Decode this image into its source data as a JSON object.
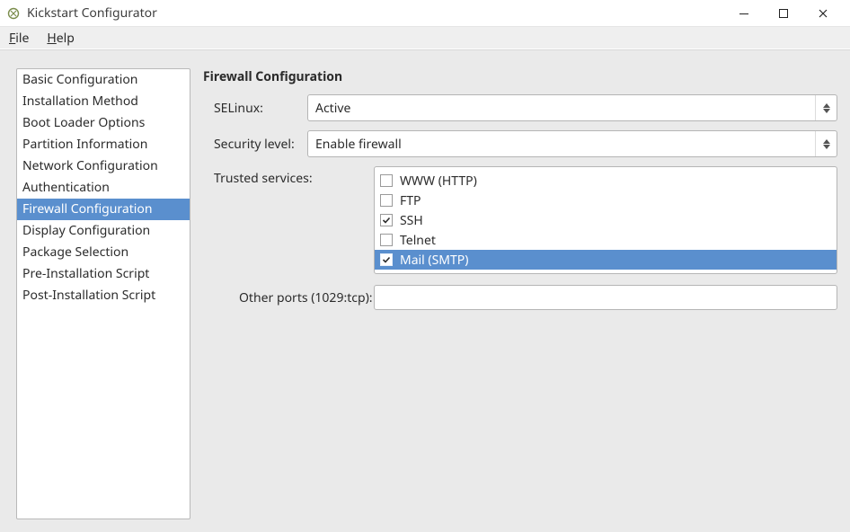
{
  "window": {
    "title": "Kickstart Configurator"
  },
  "menu": {
    "file": "File",
    "help": "Help"
  },
  "sidebar": {
    "items": [
      "Basic Configuration",
      "Installation Method",
      "Boot Loader Options",
      "Partition Information",
      "Network Configuration",
      "Authentication",
      "Firewall Configuration",
      "Display Configuration",
      "Package Selection",
      "Pre-Installation Script",
      "Post-Installation Script"
    ],
    "selected_index": 6
  },
  "panel": {
    "title": "Firewall Configuration",
    "selinux_label": "SELinux:",
    "selinux_value": "Active",
    "security_level_label": "Security level:",
    "security_level_value": "Enable firewall",
    "trusted_services_label": "Trusted services:",
    "services": [
      {
        "label": "WWW (HTTP)",
        "checked": false,
        "selected": false
      },
      {
        "label": "FTP",
        "checked": false,
        "selected": false
      },
      {
        "label": "SSH",
        "checked": true,
        "selected": false
      },
      {
        "label": "Telnet",
        "checked": false,
        "selected": false
      },
      {
        "label": "Mail (SMTP)",
        "checked": true,
        "selected": true
      }
    ],
    "other_ports_label": "Other ports (1029:tcp):",
    "other_ports_value": ""
  }
}
